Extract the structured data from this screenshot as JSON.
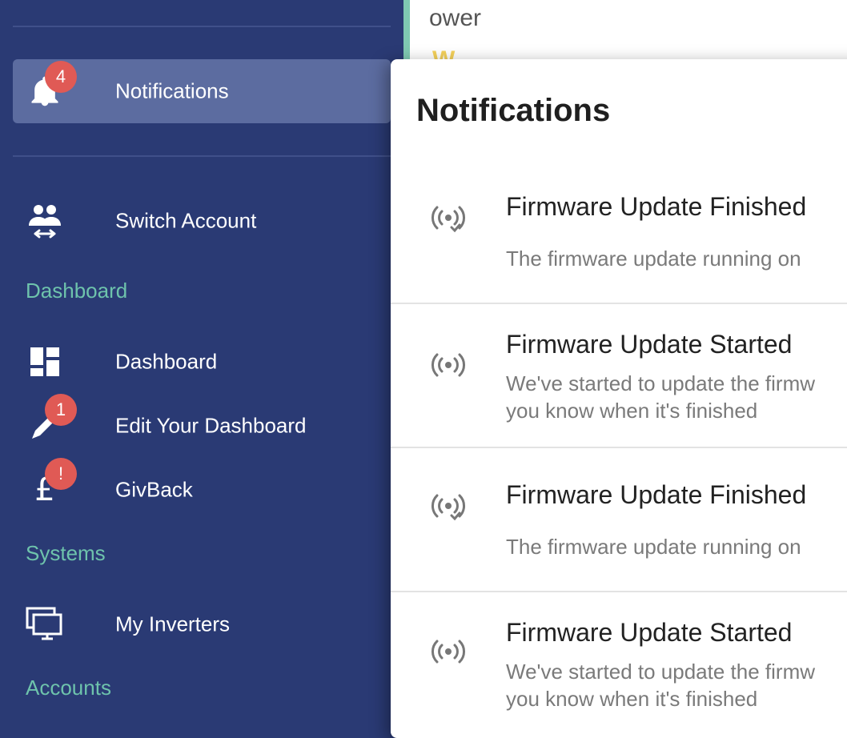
{
  "background": {
    "partial_text": "ower",
    "partial_yellow": "W"
  },
  "sidebar": {
    "notifications": {
      "label": "Notifications",
      "badge": "4"
    },
    "switch_account": {
      "label": "Switch Account"
    },
    "sections": {
      "dashboard": "Dashboard",
      "systems": "Systems",
      "accounts": "Accounts"
    },
    "items": [
      {
        "label": "Dashboard",
        "icon": "dashboard-icon"
      },
      {
        "label": "Edit Your Dashboard",
        "icon": "pencil-icon",
        "badge": "1"
      },
      {
        "label": "GivBack",
        "icon": "pound-icon",
        "badge": "!"
      },
      {
        "label": "My Inverters",
        "icon": "monitor-icon"
      }
    ]
  },
  "panel": {
    "title": "Notifications",
    "notifications": [
      {
        "title": "Firmware Update Finished",
        "body_line1": "The firmware update running on",
        "body_line2": "",
        "icon": "signal-check-icon"
      },
      {
        "title": "Firmware Update Started",
        "body_line1": "We've started to update the firmw",
        "body_line2": "you know when it's finished",
        "icon": "signal-icon"
      },
      {
        "title": "Firmware Update Finished",
        "body_line1": "The firmware update running on",
        "body_line2": "",
        "icon": "signal-check-icon"
      },
      {
        "title": "Firmware Update Started",
        "body_line1": "We've started to update the firmw",
        "body_line2": "you know when it's finished",
        "icon": "signal-icon"
      }
    ]
  },
  "colors": {
    "sidebar_bg": "#2a3a74",
    "active_item_bg": "#5c6ca0",
    "section_label": "#6ec3ac",
    "badge": "#e05a55"
  }
}
